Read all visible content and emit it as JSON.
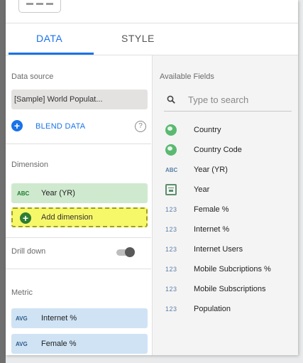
{
  "tabs": [
    {
      "label": "DATA",
      "active": true
    },
    {
      "label": "STYLE",
      "active": false
    }
  ],
  "data_source": {
    "heading": "Data source",
    "name": "[Sample] World Populat...",
    "blend_label": "BLEND DATA",
    "help": "?"
  },
  "dimension": {
    "heading": "Dimension",
    "items": [
      {
        "type": "ABC",
        "label": "Year (YR)"
      }
    ],
    "add_label": "Add dimension"
  },
  "drill_down": {
    "label": "Drill down",
    "enabled": false
  },
  "metric": {
    "heading": "Metric",
    "items": [
      {
        "type": "AVG",
        "label": "Internet %"
      },
      {
        "type": "AVG",
        "label": "Female %"
      }
    ]
  },
  "available_fields": {
    "heading": "Available Fields",
    "search_placeholder": "Type to search",
    "fields": [
      {
        "icon": "globe-icon",
        "type": "",
        "label": "Country"
      },
      {
        "icon": "globe-icon",
        "type": "",
        "label": "Country Code"
      },
      {
        "icon": "text-icon",
        "type": "ABC",
        "label": "Year (YR)"
      },
      {
        "icon": "calendar-icon",
        "type": "",
        "label": "Year"
      },
      {
        "icon": "number-icon",
        "type": "123",
        "label": "Female %"
      },
      {
        "icon": "number-icon",
        "type": "123",
        "label": "Internet %"
      },
      {
        "icon": "number-icon",
        "type": "123",
        "label": "Internet Users"
      },
      {
        "icon": "number-icon",
        "type": "123",
        "label": "Mobile Subcriptions %"
      },
      {
        "icon": "number-icon",
        "type": "123",
        "label": "Mobile Subscriptions"
      },
      {
        "icon": "number-icon",
        "type": "123",
        "label": "Population"
      }
    ]
  },
  "colors": {
    "accent": "#1a73e8",
    "dimension_bg": "#cfe9cf",
    "metric_bg": "#cfe3f5",
    "highlight": "#f7f76a"
  }
}
